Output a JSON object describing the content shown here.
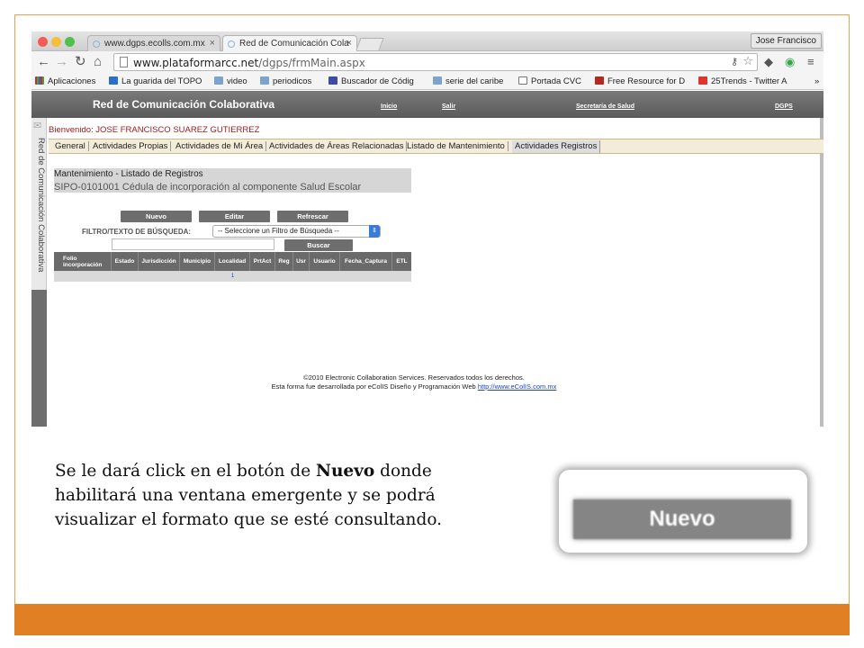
{
  "browser": {
    "tabs": [
      {
        "title": "www.dgps.ecolls.com.mx"
      },
      {
        "title": "Red de Comunicación Cola"
      }
    ],
    "close_glyph": "×",
    "user_name": "Jose Francisco",
    "url_host": "www.plataformarcc.net",
    "url_path": "/dgps/frmMain.aspx",
    "bookmarks": [
      {
        "label": "Aplicaciones",
        "icon": "apps-grid-icon"
      },
      {
        "label": "La guarida del TOPO",
        "icon": "p-favicon"
      },
      {
        "label": "video",
        "icon": "folder-icon"
      },
      {
        "label": "periodicos",
        "icon": "folder-icon"
      },
      {
        "label": "Buscador de Códig",
        "icon": "puzzle-favicon"
      },
      {
        "label": "serie del caribe",
        "icon": "folder-icon"
      },
      {
        "label": "Portada CVC",
        "icon": "page-icon"
      },
      {
        "label": "Free Resource for D",
        "icon": "d-favicon"
      },
      {
        "label": "25Trends - Twitter A",
        "icon": "25-favicon"
      }
    ],
    "more_glyph": "»"
  },
  "app": {
    "title": "Red de Comunicación Colaborativa",
    "nav": [
      "Inicio",
      "Salir",
      "Secretaría de Salud",
      "DGPS"
    ],
    "side_label": "Red de Comunicación Colaborativa",
    "welcome": "Bienvenido: JOSE FRANCISCO SUAREZ GUTIERREZ",
    "menu": [
      "General",
      "Actividades Propias",
      "Actividades de Mi Área",
      "Actividades de Áreas Relacionadas",
      "Listado de Mantenimiento",
      "Actividades Registros"
    ],
    "panel": {
      "heading": "Mantenimiento - Listado de Registros",
      "subtitle": "SIPO-0101001 Cédula de incorporación al componente Salud Escolar"
    },
    "buttons": {
      "new": "Nuevo",
      "edit": "Editar",
      "refresh": "Refrescar",
      "search": "Buscar"
    },
    "filter": {
      "label": "FILTRO/TEXTO DE BÚSQUEDA:",
      "selected": "-- Seleccione un Filtro de Búsqueda --",
      "text_value": ""
    },
    "table": {
      "columns": [
        "Folio incorporación",
        "Estado",
        "Jurisdicción",
        "Municipio",
        "Localidad",
        "PrtAct",
        "Reg",
        "Usr",
        "Usuario",
        "Fecha_Captura",
        "ETL"
      ],
      "pager": "1"
    },
    "footer": {
      "line1": "©2010 Electronic Collaboration Services. Reservados todos los derechos.",
      "line2": "Esta forma fue desarrollada por eColIS Diseño y Programación Web",
      "link": "http://www.eColIS.com.mx"
    }
  },
  "slide": {
    "caption_before": "Se le dará click en el botón de ",
    "caption_bold": "Nuevo",
    "caption_after": " donde habilitará una ventana emergente y se podrá visualizar el formato que se esté consultando.",
    "zoom_label": "Nuevo"
  },
  "colors": {
    "accent_orange": "#e07f24",
    "button_gray": "#6e6e6e",
    "welcome_red": "#a01c1c"
  }
}
